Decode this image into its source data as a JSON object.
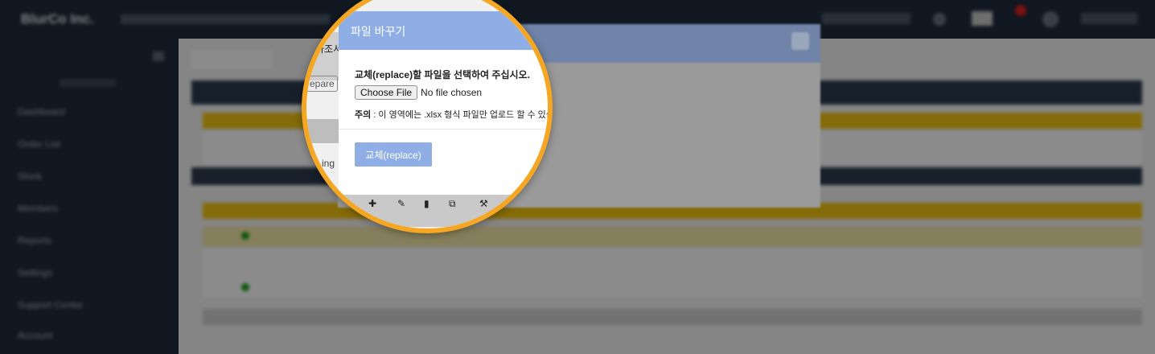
{
  "background": {
    "brand": "BlurCo Inc.",
    "sidebar_items": [
      "Dashboard",
      "Order List",
      "Stock",
      "Members",
      "Reports",
      "Settings",
      "Support Center",
      "Account"
    ],
    "lens_fragments": {
      "tab_fragment": "사조서",
      "compare_fragment": "epare",
      "bottom_fragment": "ing"
    }
  },
  "modal": {
    "title": "파일 바꾸기",
    "instruction_bold": "교체(replace)",
    "instruction_rest": "할 파일을 선택하여 주십시오.",
    "file_input": {
      "button_label": "Choose File",
      "status": "No file chosen"
    },
    "note_label": "주의",
    "note_text": " : 이 영역에는 .xlsx 형식 파일만 업로드 할 수 있습니다.",
    "replace_button": "교체(replace)"
  },
  "colors": {
    "modal_header": "#8eaee5",
    "lens_border": "#f5a623",
    "topbar": "#1f2c3c",
    "accent_yellow": "#f1c40f"
  },
  "icons": [
    "close-icon",
    "plus-icon",
    "pencil-icon",
    "document-icon",
    "export-icon",
    "tool-icon"
  ]
}
